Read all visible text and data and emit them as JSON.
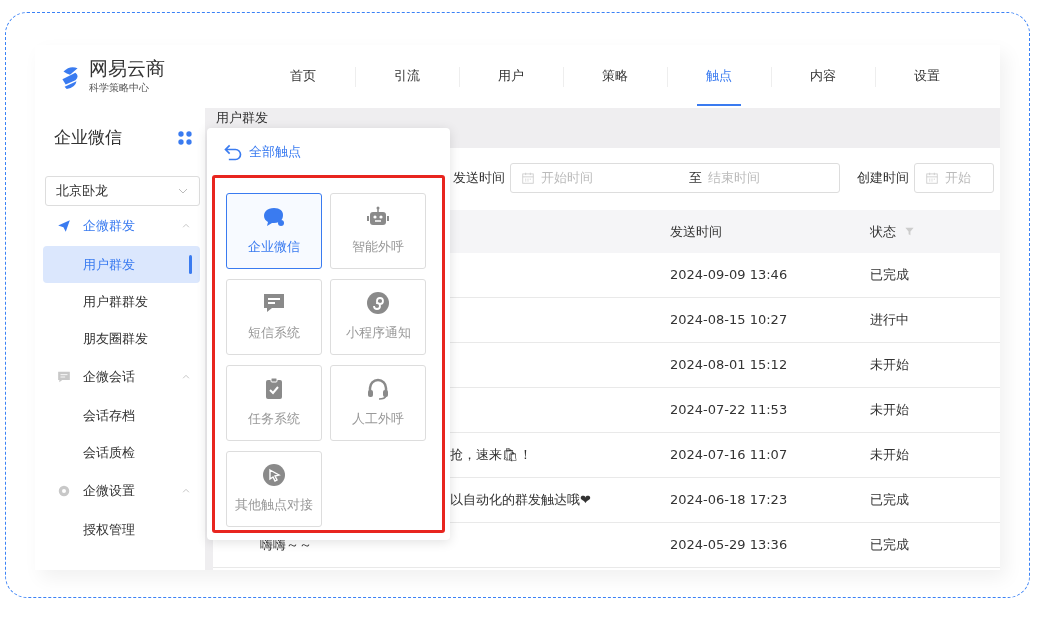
{
  "logo": {
    "name": "网易云商",
    "tagline": "科学策略中心"
  },
  "nav_tabs": [
    {
      "label": "首页",
      "selected": false
    },
    {
      "label": "引流",
      "selected": false
    },
    {
      "label": "用户",
      "selected": false
    },
    {
      "label": "策略",
      "selected": false
    },
    {
      "label": "触点",
      "selected": true
    },
    {
      "label": "内容",
      "selected": false
    },
    {
      "label": "设置",
      "selected": false
    }
  ],
  "sidebar": {
    "title": "企业微信",
    "account_select": {
      "value": "北京卧龙"
    },
    "groups": [
      {
        "label": "企微群发",
        "kind": "send",
        "active": true,
        "expanded": true,
        "items": [
          {
            "label": "用户群发",
            "selected": true
          },
          {
            "label": "用户群群发",
            "selected": false
          },
          {
            "label": "朋友圈群发",
            "selected": false
          }
        ]
      },
      {
        "label": "企微会话",
        "kind": "chat",
        "active": false,
        "expanded": true,
        "items": [
          {
            "label": "会话存档",
            "selected": false
          },
          {
            "label": "会话质检",
            "selected": false
          }
        ]
      },
      {
        "label": "企微设置",
        "kind": "gear",
        "active": false,
        "expanded": true,
        "items": [
          {
            "label": "授权管理",
            "selected": false
          }
        ]
      }
    ]
  },
  "breadcrumb": "用户群发",
  "popover": {
    "title": "全部触点",
    "tiles": [
      {
        "label": "企业微信",
        "kind": "wecom",
        "selected": true
      },
      {
        "label": "智能外呼",
        "kind": "robot",
        "selected": false
      },
      {
        "label": "短信系统",
        "kind": "sms",
        "selected": false
      },
      {
        "label": "小程序通知",
        "kind": "miniprogram",
        "selected": false
      },
      {
        "label": "任务系统",
        "kind": "task",
        "selected": false
      },
      {
        "label": "人工外呼",
        "kind": "headset",
        "selected": false
      },
      {
        "label": "其他触点对接",
        "kind": "pointer",
        "selected": false
      }
    ]
  },
  "filters": [
    {
      "label": "发送时间",
      "start_placeholder": "开始时间",
      "separator": "至",
      "end_placeholder": "结束时间"
    },
    {
      "label": "创建时间",
      "start_placeholder": "开始"
    }
  ],
  "table": {
    "columns": [
      {
        "label": "发送时间",
        "filter": false
      },
      {
        "label": "状态",
        "filter": true
      }
    ],
    "rows": [
      {
        "send_time": "2024-09-09 13:46",
        "status": "已完成"
      },
      {
        "send_time": "2024-08-15 10:27",
        "status": "进行中"
      },
      {
        "send_time": "2024-08-01 15:12",
        "status": "未开始"
      },
      {
        "send_time": "2024-07-22 11:53",
        "status": "未开始"
      },
      {
        "message": {
          "text": "抢，速来🛍！",
          "clipped": true
        },
        "send_time": "2024-07-16 11:07",
        "status": "未开始"
      },
      {
        "message": {
          "text": "以自动化的群发触达哦❤",
          "clipped": true
        },
        "send_time": "2024-06-18 17:23",
        "status": "已完成"
      },
      {
        "message": {
          "text": "嗨嗨～～",
          "clipped": false
        },
        "send_time": "2024-05-29 13:36",
        "status": "已完成"
      }
    ]
  }
}
